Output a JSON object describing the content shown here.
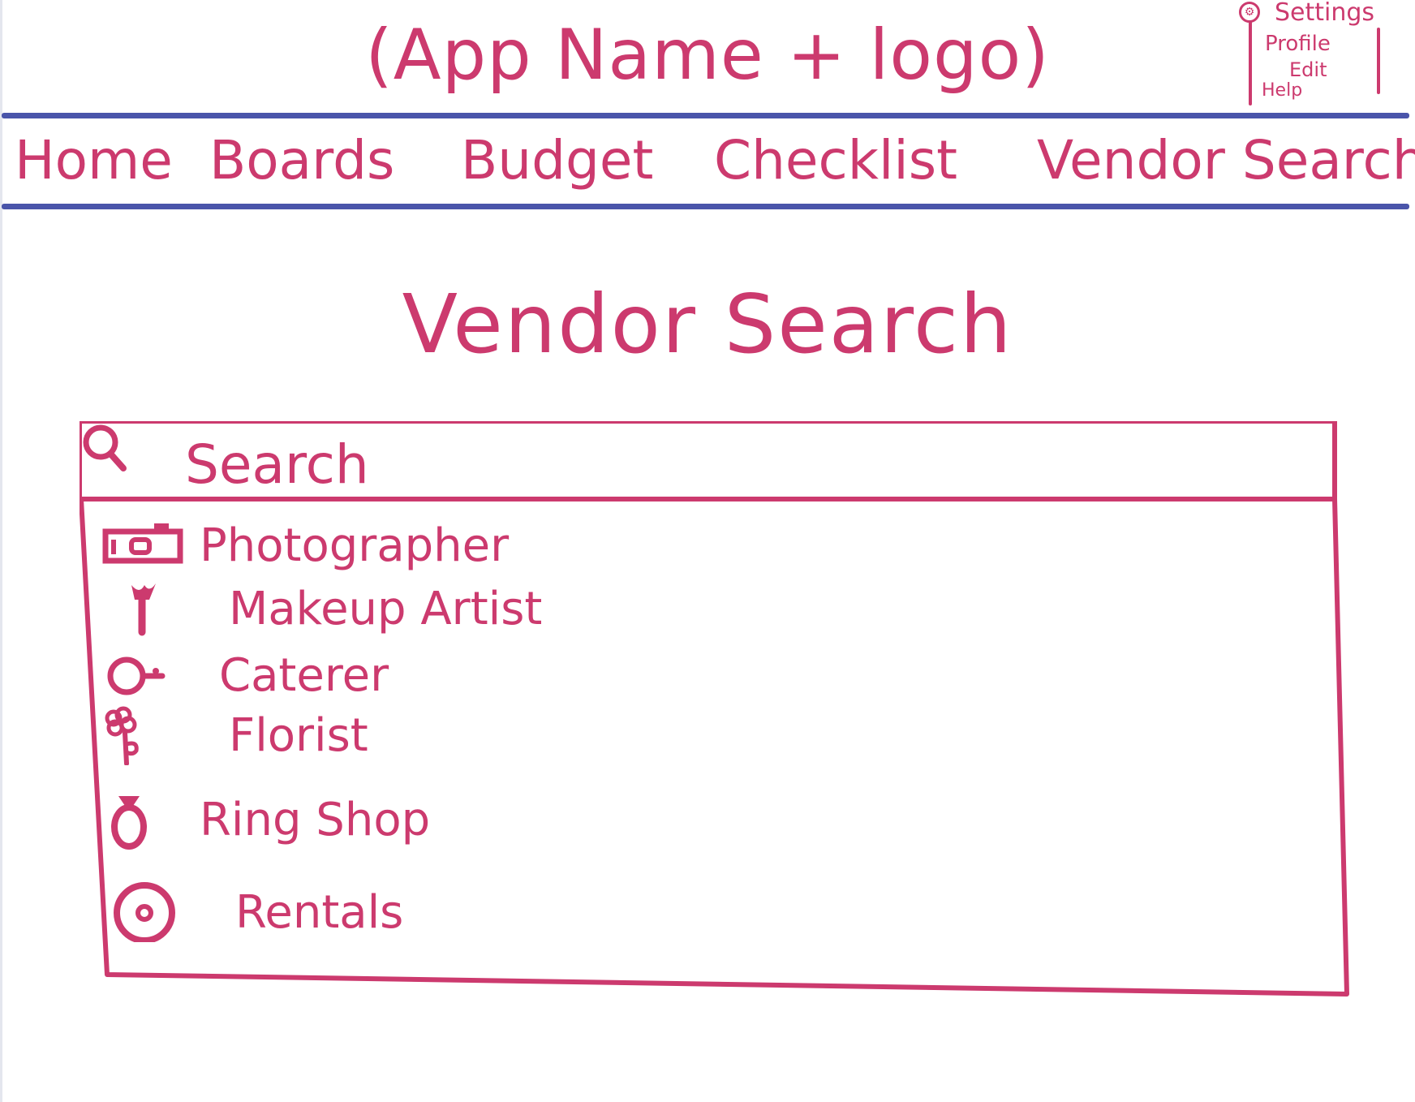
{
  "header": {
    "app_title": "(App Name + logo)",
    "user_menu": {
      "items": [
        "Settings",
        "Profile",
        "Edit",
        "Help"
      ]
    }
  },
  "nav": {
    "tabs": [
      "Home",
      "Boards",
      "Budget",
      "Checklist",
      "Vendor Search"
    ]
  },
  "main": {
    "title": "Vendor Search",
    "search": {
      "placeholder": "Search"
    },
    "vendors": [
      {
        "label": "Photographer",
        "icon": "camera-icon"
      },
      {
        "label": "Makeup Artist",
        "icon": "makeup-brush-icon"
      },
      {
        "label": "Caterer",
        "icon": "food-plate-icon"
      },
      {
        "label": "Florist",
        "icon": "flower-icon"
      },
      {
        "label": "Ring Shop",
        "icon": "ring-icon"
      },
      {
        "label": "Rentals",
        "icon": "rentals-icon"
      }
    ]
  },
  "colors": {
    "ink": "#cc3a6e",
    "rule": "#4a55aa",
    "background": "#ffffff"
  }
}
